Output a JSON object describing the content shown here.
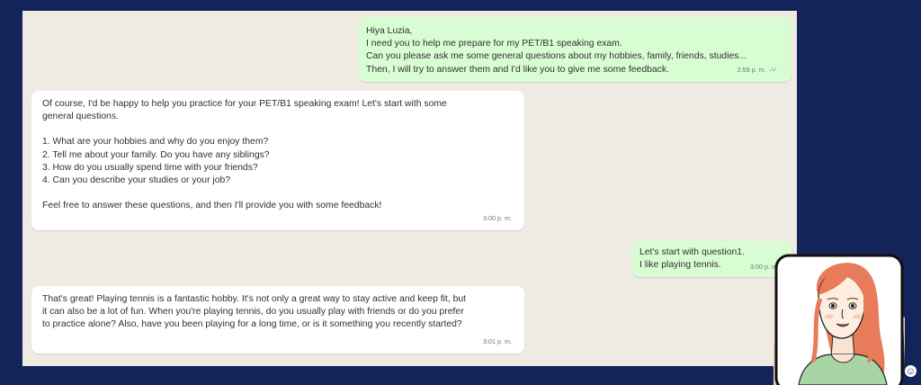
{
  "messages": [
    {
      "direction": "out",
      "lines": [
        "Hiya Luzia,",
        "I need you to help me prepare for my PET/B1 speaking exam.",
        "Can you please ask me some general questions about my hobbies, family, friends, studies...",
        "Then, I will try to answer them and I'd like you to give me some feedback."
      ],
      "time": "2:59 p. m."
    },
    {
      "direction": "in",
      "intro": [
        "Of course, I'd be happy to help you practice for your PET/B1 speaking exam! Let's start with some",
        "general questions."
      ],
      "list": [
        "1.  What are your hobbies and why do you enjoy them?",
        "2.  Tell me about your family. Do you have any siblings?",
        "3.  How do you usually spend time with your friends?",
        "4.  Can you describe your studies or your job?"
      ],
      "outro": "Feel free to answer these questions, and then I'll provide you with some feedback!",
      "time": "3:00 p. m."
    },
    {
      "direction": "out",
      "lines": [
        "Let's start with question1.",
        "I like playing tennis."
      ],
      "time": "3:00 p. m."
    },
    {
      "direction": "in",
      "lines": [
        "That's great! Playing tennis is a fantastic hobby. It's not only a great way to stay active and keep fit, but",
        "it can also be a lot of fun. When you're playing tennis, do you usually play with friends or do you prefer",
        "to practice alone? Also, have you been playing for a long time, or is it something you recently started?"
      ],
      "time": "3:01 p. m."
    }
  ],
  "icons": {
    "read_receipt": "double-check-icon",
    "badge": "smiley-icon",
    "badge_glyph": "☺",
    "check_glyph": "✓✓"
  },
  "colors": {
    "background": "#13245a",
    "chat_wallpaper": "#efeae2",
    "outgoing_bubble": "#d9fdd3",
    "incoming_bubble": "#ffffff",
    "read_check": "#53bdeb"
  }
}
